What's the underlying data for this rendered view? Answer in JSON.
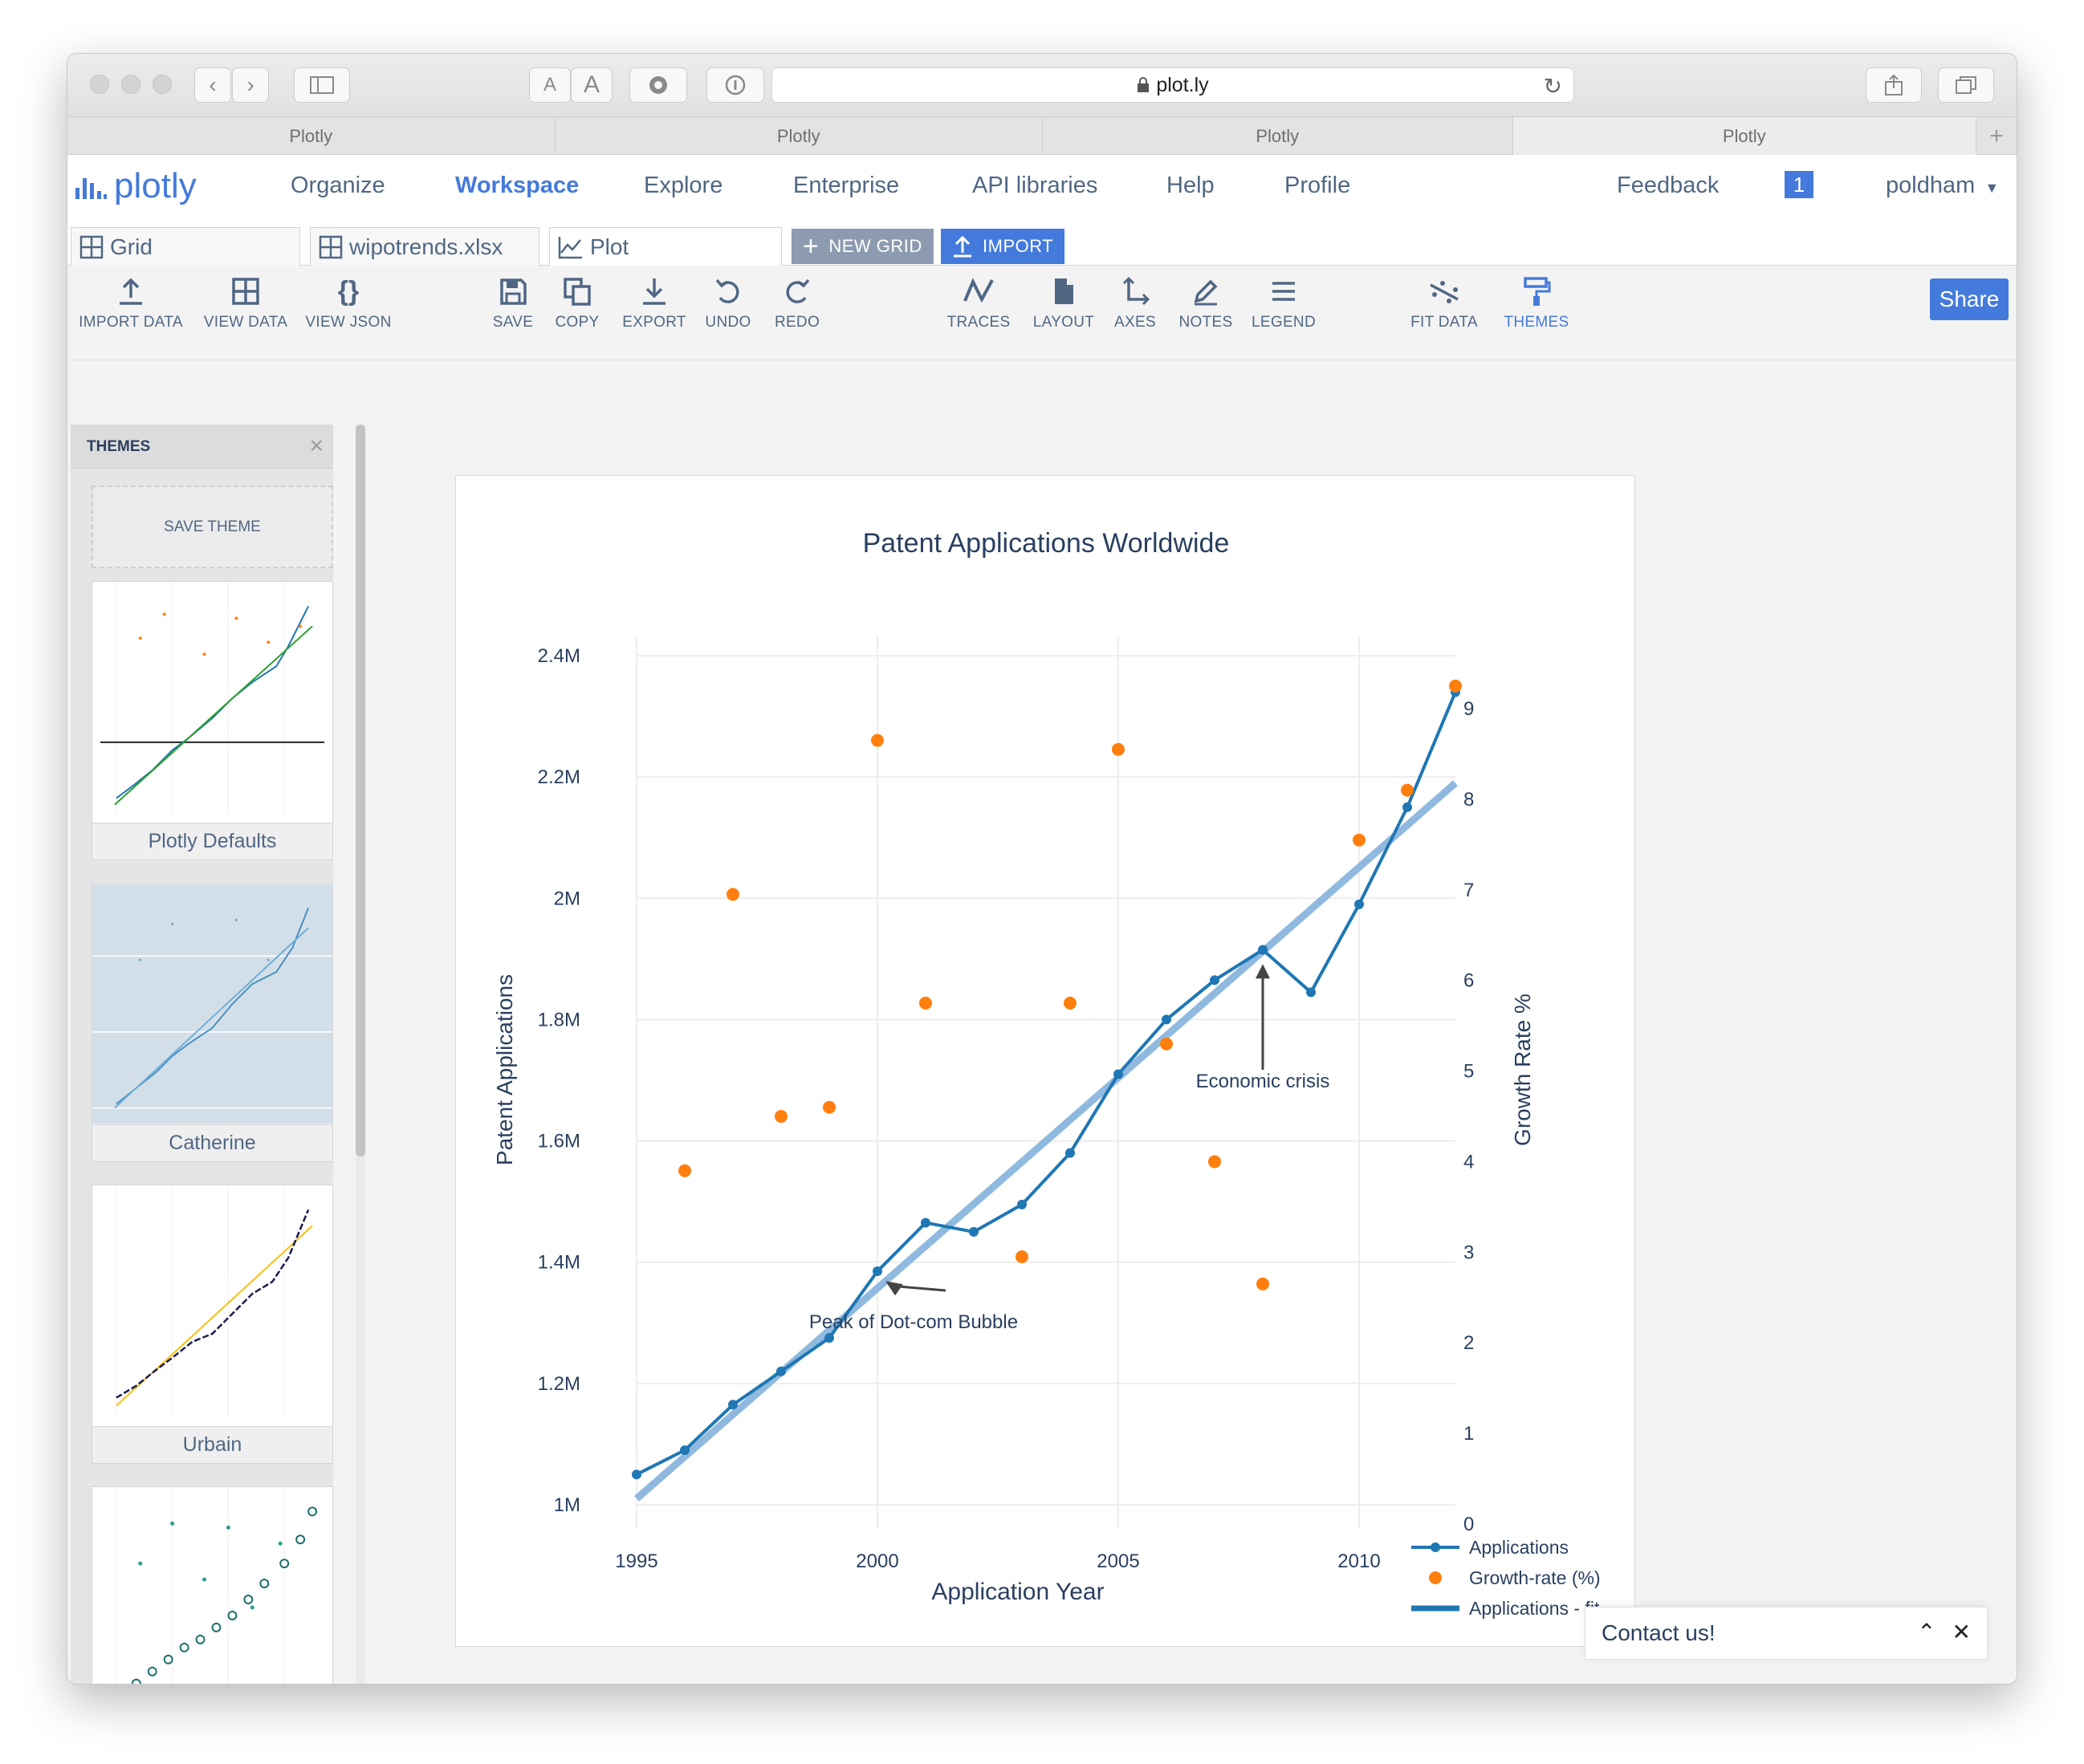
{
  "browser": {
    "url": "plot.ly",
    "tabs": [
      "Plotly",
      "Plotly",
      "Plotly",
      "Plotly"
    ],
    "font_size_small": "A",
    "font_size_large": "A"
  },
  "nav": {
    "logo": "plotly",
    "items": [
      "Organize",
      "Workspace",
      "Explore",
      "Enterprise",
      "API libraries",
      "Help",
      "Profile"
    ],
    "active": "Workspace",
    "feedback": "Feedback",
    "notifications": "1",
    "user": "poldham"
  },
  "filetabs": {
    "grid": "Grid",
    "file": "wipotrends.xlsx",
    "plot": "Plot",
    "new_grid": "NEW GRID",
    "import": "IMPORT"
  },
  "toolbar": {
    "import_data": "IMPORT DATA",
    "view_data": "VIEW DATA",
    "view_json": "VIEW JSON",
    "save": "SAVE",
    "copy": "COPY",
    "export": "EXPORT",
    "undo": "UNDO",
    "redo": "REDO",
    "traces": "TRACES",
    "layout": "LAYOUT",
    "axes": "AXES",
    "notes": "NOTES",
    "legend": "LEGEND",
    "fit_data": "FIT DATA",
    "themes": "THEMES",
    "share": "Share",
    "view_json_glyph": "{}"
  },
  "themes_panel": {
    "title": "THEMES",
    "save_theme": "SAVE THEME",
    "themes": [
      "Plotly Defaults",
      "Catherine",
      "Urbain"
    ]
  },
  "contact": {
    "label": "Contact us!"
  },
  "colors": {
    "accent": "#447adb",
    "line": "#1f77b4",
    "scatter": "#ff7f0e",
    "fit": "#8fb9de",
    "text": "#2a3f5f"
  },
  "chart_data": {
    "type": "line",
    "title": "Patent Applications Worldwide",
    "xlabel": "Application Year",
    "ylabel": "Patent Applications",
    "y2label": "Growth Rate %",
    "xlim": [
      1995,
      2012
    ],
    "ylim": [
      1000000,
      2400000
    ],
    "y2lim": [
      0,
      9
    ],
    "x_ticks": [
      1995,
      2000,
      2005,
      2010
    ],
    "x_tick_labels": [
      "1995",
      "2000",
      "2005",
      "2010"
    ],
    "y_ticks": [
      1000000,
      1200000,
      1400000,
      1600000,
      1800000,
      2000000,
      2200000,
      2400000
    ],
    "y_tick_labels": [
      "1M",
      "1.2M",
      "1.4M",
      "1.6M",
      "1.8M",
      "2M",
      "2.2M",
      "2.4M"
    ],
    "y2_ticks": [
      0,
      1,
      2,
      3,
      4,
      5,
      6,
      7,
      8,
      9
    ],
    "y2_tick_labels": [
      "0",
      "1",
      "2",
      "3",
      "4",
      "5",
      "6",
      "7",
      "8",
      "9"
    ],
    "grid": true,
    "legend_position": "bottom-right",
    "series": [
      {
        "name": "Applications",
        "kind": "line+markers",
        "axis": "y",
        "x": [
          1995,
          1996,
          1997,
          1998,
          1999,
          2000,
          2001,
          2002,
          2003,
          2004,
          2005,
          2006,
          2007,
          2008,
          2009,
          2010,
          2011,
          2012
        ],
        "y": [
          1050000,
          1090000,
          1165000,
          1220000,
          1275000,
          1385000,
          1465000,
          1450000,
          1495000,
          1580000,
          1710000,
          1800000,
          1865000,
          1915000,
          1845000,
          1990000,
          2150000,
          2340000
        ]
      },
      {
        "name": "Growth-rate (%)",
        "kind": "markers",
        "axis": "y2",
        "x": [
          1996,
          1997,
          1998,
          1999,
          2000,
          2001,
          2003,
          2004,
          2005,
          2006,
          2007,
          2008,
          2010,
          2011,
          2012
        ],
        "y": [
          3.9,
          6.95,
          4.5,
          4.6,
          8.65,
          5.75,
          2.95,
          5.75,
          8.55,
          5.3,
          4.0,
          2.65,
          7.55,
          8.1,
          9.25
        ]
      },
      {
        "name": "Applications - fit",
        "kind": "line",
        "axis": "y",
        "x": [
          1995,
          2012
        ],
        "y": [
          1010000,
          2190000
        ]
      }
    ],
    "annotations": [
      {
        "text": "Peak of Dot-com Bubble",
        "x": 2000,
        "y": 1390000
      },
      {
        "text": "Economic crisis",
        "x": 2008,
        "y": 1910000
      }
    ]
  }
}
